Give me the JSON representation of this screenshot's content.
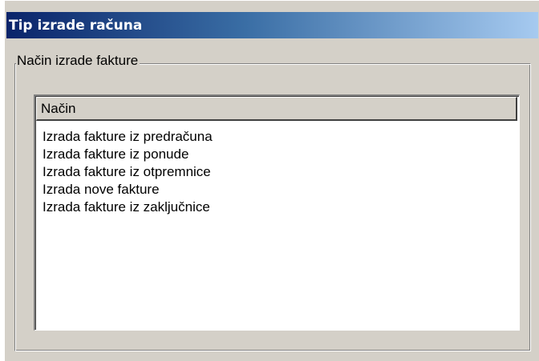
{
  "window": {
    "title": "Tip izrade računa"
  },
  "group": {
    "label": "Način izrade fakture"
  },
  "list": {
    "columns": [
      "Način"
    ],
    "rows": [
      "Izrada fakture iz predračuna",
      "Izrada fakture iz ponude",
      "Izrada fakture iz otpremnice",
      "Izrada nove fakture",
      "Izrada fakture iz zaključnice"
    ]
  },
  "colors": {
    "titlebar_start": "#0a246a",
    "titlebar_end": "#a6caf0",
    "window_face": "#d4d0c8",
    "list_background": "#ffffff"
  }
}
